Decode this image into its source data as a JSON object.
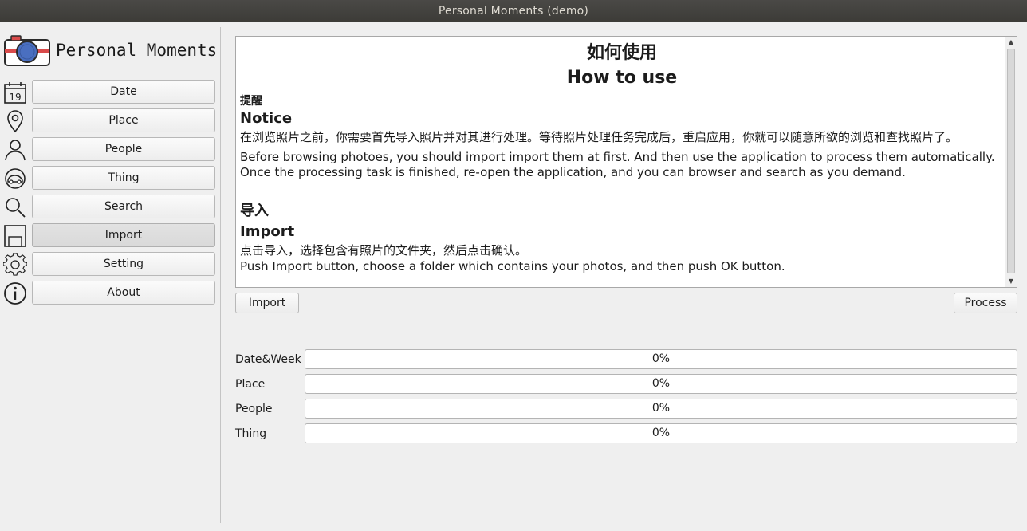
{
  "window": {
    "title": "Personal Moments (demo)"
  },
  "app": {
    "logo_text": "Personal Moments"
  },
  "sidebar": {
    "items": [
      {
        "label": "Date",
        "icon": "calendar-icon",
        "icon_text": "19"
      },
      {
        "label": "Place",
        "icon": "map-pin-icon"
      },
      {
        "label": "People",
        "icon": "person-icon"
      },
      {
        "label": "Thing",
        "icon": "car-icon"
      },
      {
        "label": "Search",
        "icon": "search-icon"
      },
      {
        "label": "Import",
        "icon": "floppy-icon",
        "active": true
      },
      {
        "label": "Setting",
        "icon": "gear-icon"
      },
      {
        "label": "About",
        "icon": "info-icon"
      }
    ]
  },
  "howto": {
    "title_cn": "如何使用",
    "title_en": "How to use",
    "notice_cn": "提醒",
    "notice_en": "Notice",
    "notice_body_cn": "在浏览照片之前，你需要首先导入照片并对其进行处理。等待照片处理任务完成后，重启应用，你就可以随意所欲的浏览和查找照片了。",
    "notice_body_en": "Before browsing photoes, you should import import them at first. And then use the application to process them automatically. Once the processing task is finished, re-open the application, and you can browser and search as you demand.",
    "import_cn": "导入",
    "import_en": "Import",
    "import_body_cn": "点击导入，选择包含有照片的文件夹，然后点击确认。",
    "import_body_en": "Push Import button, choose a folder which contains your photos, and then push OK button."
  },
  "actions": {
    "import_label": "Import",
    "process_label": "Process"
  },
  "progress": [
    {
      "label": "Date&Week",
      "value_text": "0%",
      "value": 0
    },
    {
      "label": "Place",
      "value_text": "0%",
      "value": 0
    },
    {
      "label": "People",
      "value_text": "0%",
      "value": 0
    },
    {
      "label": "Thing",
      "value_text": "0%",
      "value": 0
    }
  ],
  "colors": {
    "progress_fill": "#e95420",
    "logo_camera_body": "#3a3a3a",
    "logo_lens": "#4a6fc0",
    "logo_stripe": "#d94b4b"
  }
}
